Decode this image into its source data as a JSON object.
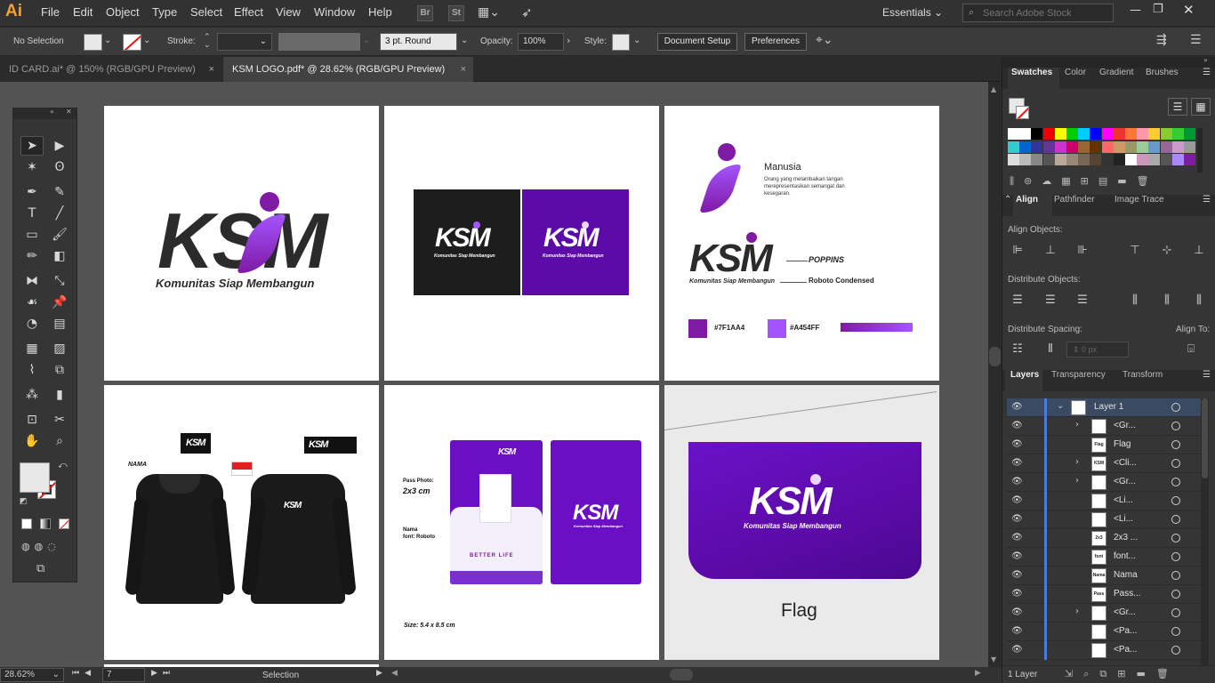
{
  "app": {
    "logo": "Ai",
    "menu": [
      "File",
      "Edit",
      "Object",
      "Type",
      "Select",
      "Effect",
      "View",
      "Window",
      "Help"
    ],
    "bridge": "Br",
    "stock": "St",
    "workspace": "Essentials",
    "search_placeholder": "Search Adobe Stock"
  },
  "control": {
    "selection": "No Selection",
    "stroke_label": "Stroke:",
    "brush": "3 pt. Round",
    "opacity_label": "Opacity:",
    "opacity_value": "100%",
    "style_label": "Style:",
    "document_setup": "Document Setup",
    "preferences": "Preferences"
  },
  "tabs": [
    {
      "label": "ID CARD.ai* @ 150% (RGB/GPU Preview)",
      "close": "×"
    },
    {
      "label": "KSM LOGO.pdf* @ 28.62% (RGB/GPU Preview)",
      "close": "×"
    }
  ],
  "art": {
    "ksm": "KSM",
    "tagline": "Komunitas Siap Membangun",
    "manusia_title": "Manusia",
    "manusia_desc": "Orang yang melambaikan tangan merepresentasikan semangat dan kesegaran.",
    "font_primary": "POPPINS",
    "font_secondary": "Roboto Condensed",
    "color1": "#7F1AA4",
    "color2": "#A454FF",
    "nama": "NAMA",
    "pass_photo": "Pass Photo:",
    "pass_size": "2x3 cm",
    "nama_label": "Nama",
    "font_label": "font: Roboto",
    "better_life": "BETTER LIFE",
    "size": "Size:  5.4 x 8.5 cm",
    "flag": "Flag"
  },
  "status": {
    "zoom": "28.62%",
    "page": "7",
    "tool": "Selection"
  },
  "panels": {
    "swatch_tabs": [
      "Swatches",
      "Color",
      "Gradient",
      "Brushes"
    ],
    "align_tabs": [
      "Align",
      "Pathfinder",
      "Image Trace"
    ],
    "align_objects": "Align Objects:",
    "distribute_objects": "Distribute Objects:",
    "distribute_spacing": "Distribute Spacing:",
    "align_to": "Align To:",
    "spacing_value": "0 px",
    "layer_tabs": [
      "Layers",
      "Transparency",
      "Transform"
    ],
    "layers_count": "1 Layer",
    "layers": [
      {
        "name": "Layer 1",
        "thumb": "",
        "arrow": "⌄",
        "top": true
      },
      {
        "name": "<Gr...",
        "thumb": "",
        "arrow": "›"
      },
      {
        "name": "Flag",
        "thumb": "Flag",
        "arrow": ""
      },
      {
        "name": "<Cli...",
        "thumb": "KSM",
        "arrow": "›"
      },
      {
        "name": "<Gr...",
        "thumb": "",
        "arrow": "›"
      },
      {
        "name": "<Li...",
        "thumb": "",
        "arrow": ""
      },
      {
        "name": "<Li...",
        "thumb": "",
        "arrow": ""
      },
      {
        "name": "2x3 ...",
        "thumb": "2x3",
        "arrow": ""
      },
      {
        "name": "font...",
        "thumb": "font",
        "arrow": ""
      },
      {
        "name": "Nama",
        "thumb": "Nama",
        "arrow": ""
      },
      {
        "name": "Pass...",
        "thumb": "Pass",
        "arrow": ""
      },
      {
        "name": "<Gr...",
        "thumb": "",
        "arrow": "›"
      },
      {
        "name": "<Pa...",
        "thumb": "",
        "arrow": ""
      },
      {
        "name": "<Pa...",
        "thumb": "",
        "arrow": ""
      }
    ]
  },
  "colors": {
    "brand_purple": "#7F1AA4",
    "light_purple": "#A454FF",
    "deep_purple": "#5c0aa8",
    "ai_orange": "#f9a02b",
    "layer_blue": "#4b7bd8"
  }
}
